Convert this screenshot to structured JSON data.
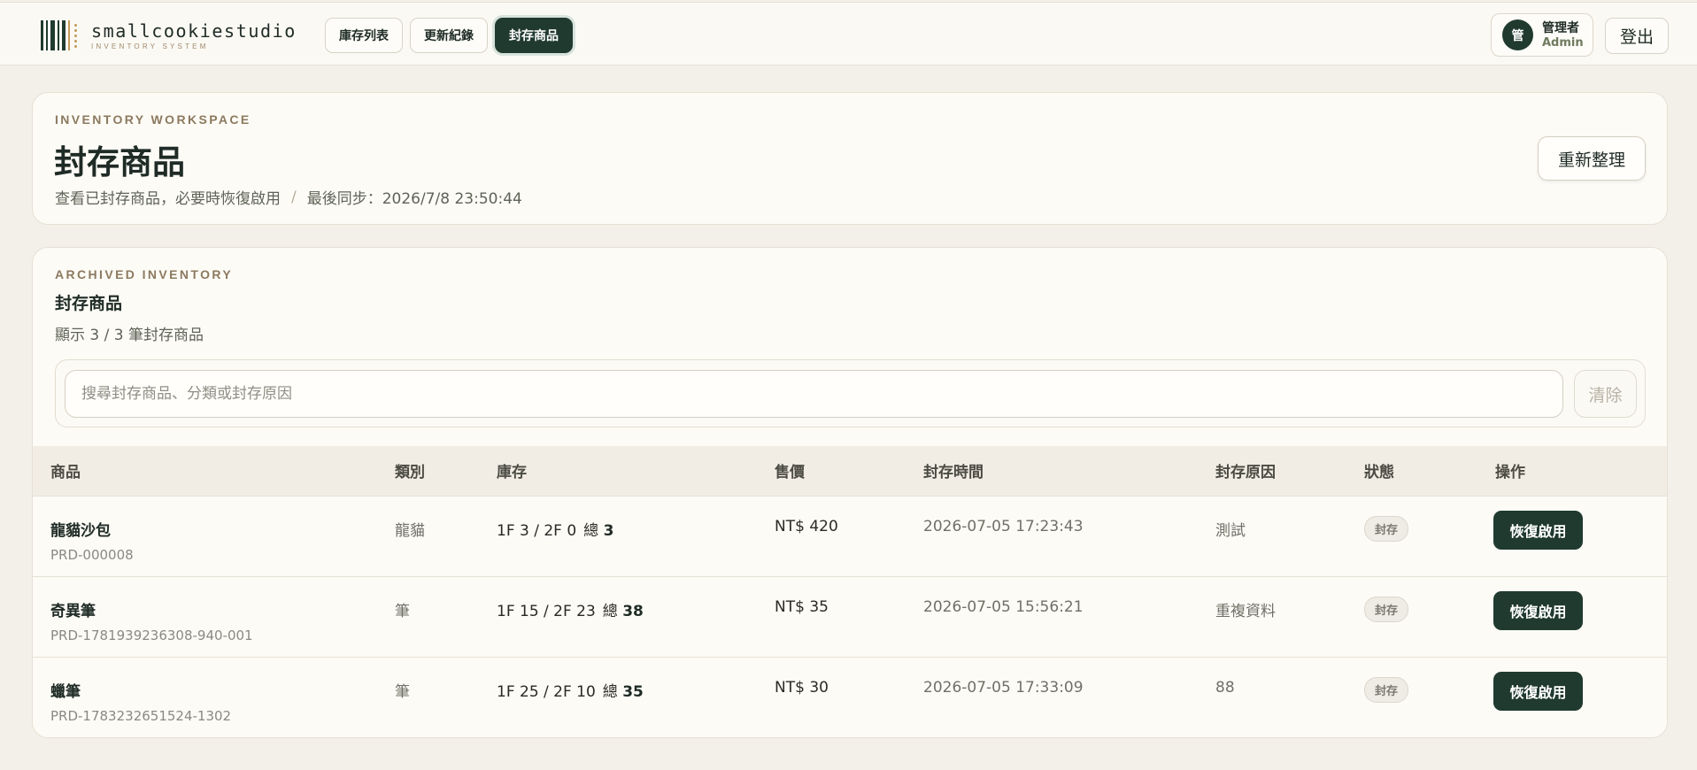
{
  "brand": {
    "name": "smallcookiestudio",
    "subtitle": "INVENTORY SYSTEM",
    "accent": "#203a30"
  },
  "nav": {
    "items": [
      {
        "label": "庫存列表",
        "active": false
      },
      {
        "label": "更新紀錄",
        "active": false
      },
      {
        "label": "封存商品",
        "active": true
      }
    ]
  },
  "user": {
    "avatar": "管",
    "role": "管理者",
    "name": "Admin",
    "logout_label": "登出"
  },
  "hero": {
    "eyebrow": "INVENTORY WORKSPACE",
    "title": "封存商品",
    "description": "查看已封存商品，必要時恢復啟用",
    "separator": "/",
    "sync": "最後同步：2026/7/8 23:50:44",
    "refresh_label": "重新整理"
  },
  "archive": {
    "eyebrow": "ARCHIVED INVENTORY",
    "title": "封存商品",
    "count_text": "顯示 3 / 3 筆封存商品",
    "search_placeholder": "搜尋封存商品、分類或封存原因",
    "search_value": "",
    "clear_label": "清除",
    "columns": [
      "商品",
      "類別",
      "庫存",
      "售價",
      "封存時間",
      "封存原因",
      "狀態",
      "操作"
    ],
    "rows": [
      {
        "name": "龍貓沙包",
        "code": "PRD-000008",
        "category": "龍貓",
        "stock_floors": "1F 3 / 2F 0",
        "stock_total_label": "總",
        "stock_total": "3",
        "price": "NT$ 420",
        "archived_at": "2026-07-05 17:23:43",
        "reason": "測試",
        "status": "封存",
        "action": "恢復啟用"
      },
      {
        "name": "奇異筆",
        "code": "PRD-1781939236308-940-001",
        "category": "筆",
        "stock_floors": "1F 15 / 2F 23",
        "stock_total_label": "總",
        "stock_total": "38",
        "price": "NT$ 35",
        "archived_at": "2026-07-05 15:56:21",
        "reason": "重複資料",
        "status": "封存",
        "action": "恢復啟用"
      },
      {
        "name": "蠟筆",
        "code": "PRD-1783232651524-1302",
        "category": "筆",
        "stock_floors": "1F 25 / 2F 10",
        "stock_total_label": "總",
        "stock_total": "35",
        "price": "NT$ 30",
        "archived_at": "2026-07-05 17:33:09",
        "reason": "88",
        "status": "封存",
        "action": "恢復啟用"
      }
    ]
  }
}
